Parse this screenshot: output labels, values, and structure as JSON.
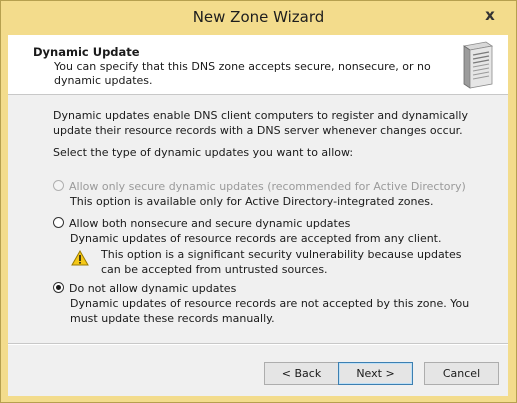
{
  "window": {
    "title": "New Zone Wizard",
    "close_glyph": "x"
  },
  "header": {
    "title": "Dynamic Update",
    "description": "You can specify that this DNS zone accepts secure, nonsecure, or no dynamic updates.",
    "icon": "server-icon"
  },
  "intro": "Dynamic updates enable DNS client computers to register and dynamically update their resource records with a DNS server whenever changes occur.",
  "select_prompt": "Select the type of dynamic updates you want to allow:",
  "options": [
    {
      "label": "Allow only secure dynamic updates (recommended for Active Directory)",
      "description": "This option is available only for Active Directory-integrated zones.",
      "enabled": false,
      "selected": false
    },
    {
      "label": "Allow both nonsecure and secure dynamic updates",
      "description": "Dynamic updates of resource records are accepted from any client.",
      "warning": "This option is a significant security vulnerability because updates can be accepted from untrusted sources.",
      "warning_icon": "warning-icon",
      "enabled": true,
      "selected": false
    },
    {
      "label": "Do not allow dynamic updates",
      "description": "Dynamic updates of resource records are not accepted by this zone. You must update these records manually.",
      "enabled": true,
      "selected": true
    }
  ],
  "buttons": {
    "back": "< Back",
    "next": "Next >",
    "cancel": "Cancel"
  },
  "colors": {
    "titlebar": "#f3dc8c",
    "dialog_background": "#f0f0f0",
    "disabled_text": "#9a9a9a",
    "default_button_border": "#3c7fb1"
  }
}
